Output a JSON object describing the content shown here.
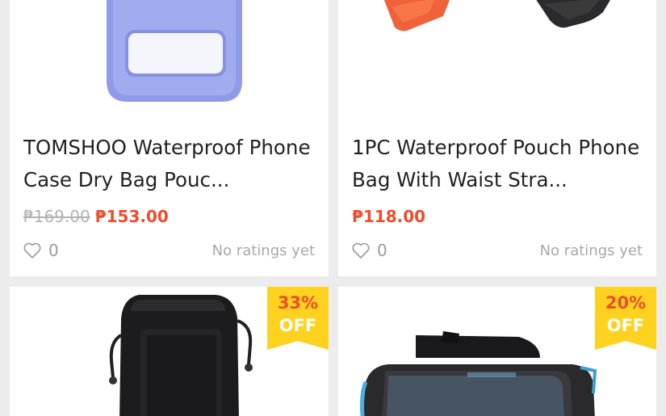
{
  "currency": "₱",
  "products": [
    {
      "title": "TOMSHOO Waterproof Phone Case Dry Bag Pouc...",
      "original_price": "₱169.00",
      "price": "₱153.00",
      "likes": "0",
      "rating_text": "No ratings yet"
    },
    {
      "title": "1PC Waterproof Pouch Phone Bag With Waist Stra...",
      "original_price": "",
      "price": "₱118.00",
      "likes": "0",
      "rating_text": "No ratings yet"
    },
    {
      "badge_percent": "33%",
      "badge_off": "OFF"
    },
    {
      "badge_percent": "20%",
      "badge_off": "OFF"
    }
  ],
  "colors": {
    "price": "#ee4d2d",
    "badge": "#ffd21f",
    "background": "#ececec"
  }
}
